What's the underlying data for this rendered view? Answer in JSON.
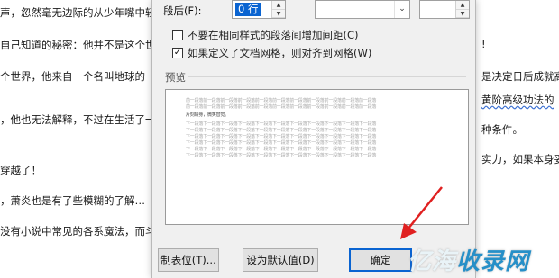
{
  "document": {
    "left_lines": [
      "声，忽然毫无边际的从少年嘴中轻",
      "自己知道的秘密：他并不是这个世",
      "个世界，他来自一个名叫地球的",
      "，他也无法解释，不过在生活了一",
      "穿越了！",
      "，萧炎也是有了些模糊的了解…",
      "没有小说中常见的各系魔法，而斗"
    ],
    "right_lines": [
      "!",
      "是决定日后成就高",
      "黄阶高级功法的",
      "种条件。",
      "实力，如果本身妥"
    ]
  },
  "dialog": {
    "after_label": "段后(F):",
    "after_value": "0 行",
    "checkbox1_label": "不要在相同样式的段落间增加间距(C)",
    "checkbox1_checked": false,
    "checkbox2_label": "如果定义了文档网格，则对齐到网格(W)",
    "checkbox2_checked": true,
    "preview_title": "预览",
    "preview": {
      "prev_line": "前一段落前一段落前一段落前一段落前一段落前一段落前一段落前一段落前一段落前一段落前一段落",
      "sample_line": "片刻转身，微笑替觉。",
      "next_line": "下一段落下一段落下一段落下一段落下一段落下一段落下一段落下一段落下一段落下一段落下一段落"
    },
    "buttons": {
      "tabs": "制表位(T)...",
      "set_default": "设为默认值(D)",
      "ok": "确定"
    }
  },
  "watermark": {
    "left": "亿海",
    "right": "收录网"
  }
}
